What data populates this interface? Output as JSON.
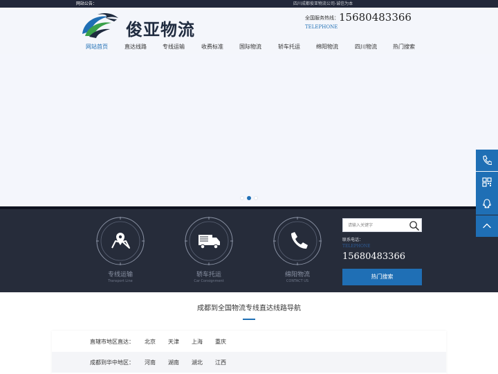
{
  "topbar": {
    "notice_label": "网站公告：",
    "slogan": "四川成都俊亚物流公司-诚信为本"
  },
  "header": {
    "logo_text": "俊亚物流",
    "hotline_label": "全国服务热线：",
    "hotline_number": "15680483366",
    "hotline_sub": "TELEPHONE"
  },
  "nav": {
    "items": [
      {
        "label": "网站首页",
        "active": true
      },
      {
        "label": "直达线路"
      },
      {
        "label": "专线运输"
      },
      {
        "label": "收费标准"
      },
      {
        "label": "国际物流"
      },
      {
        "label": "轿车托运"
      },
      {
        "label": "绵阳物流"
      },
      {
        "label": "四川物流"
      },
      {
        "label": "热门搜索"
      }
    ]
  },
  "banner": {
    "slide_count": 3,
    "active_slide": 2
  },
  "features": [
    {
      "title": "专线运输",
      "subtitle": "Transport Line",
      "icon": "map-pin-icon"
    },
    {
      "title": "轿车托运",
      "subtitle": "Car Consignment",
      "icon": "truck-icon"
    },
    {
      "title": "绵阳物流",
      "subtitle": "CONTACT US",
      "icon": "phone-icon"
    }
  ],
  "search": {
    "placeholder": "请输入关键字"
  },
  "contact": {
    "label": "联系电话：",
    "sub": "TELEPHONE",
    "number": "15680483366",
    "hot_button": "热门搜索"
  },
  "section": {
    "title": "成都到全国物流专线直达线路导航"
  },
  "routes": [
    {
      "region": "直辖市地区直达：",
      "cities": [
        "北京",
        "天津",
        "上海",
        "重庆"
      ]
    },
    {
      "region": "成都到华中地区：",
      "cities": [
        "河南",
        "湖南",
        "湖北",
        "江西"
      ]
    }
  ],
  "side_buttons": [
    "phone-icon",
    "qrcode-icon",
    "qq-icon",
    "back-to-top-icon"
  ],
  "colors": {
    "accent": "#1f6fb5",
    "dark_band": "#262c3a",
    "topbar": "#22283a"
  }
}
